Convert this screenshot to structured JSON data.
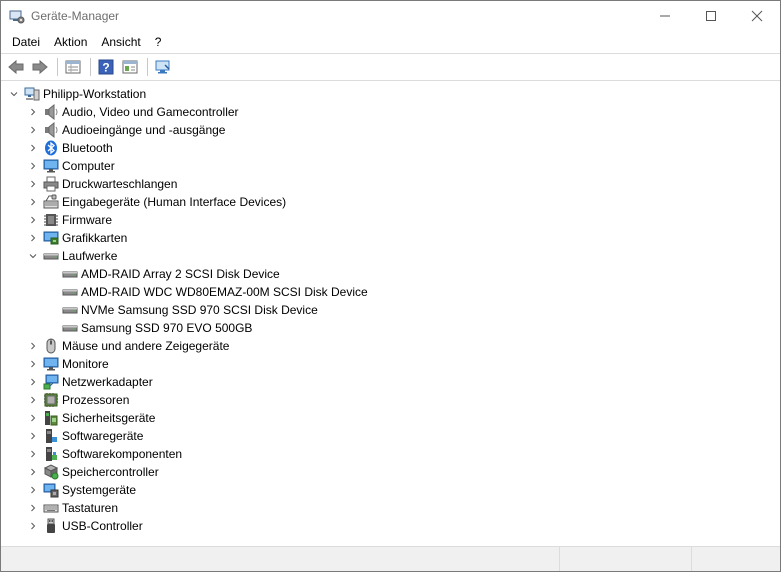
{
  "window": {
    "title": "Geräte-Manager"
  },
  "menu": [
    "Datei",
    "Aktion",
    "Ansicht",
    "?"
  ],
  "toolbar": {
    "buttons": [
      "back-icon",
      "forward-icon",
      "properties-icon",
      "help-icon",
      "show-hidden-icon",
      "scan-hardware-icon"
    ]
  },
  "tree": {
    "root": "Philipp-Workstation",
    "categories": [
      {
        "label": "Audio, Video und Gamecontroller",
        "icon": "speaker-icon"
      },
      {
        "label": "Audioeingänge und -ausgänge",
        "icon": "speaker-icon"
      },
      {
        "label": "Bluetooth",
        "icon": "bluetooth-icon"
      },
      {
        "label": "Computer",
        "icon": "computer-icon"
      },
      {
        "label": "Druckwarteschlangen",
        "icon": "printer-icon"
      },
      {
        "label": "Eingabegeräte (Human Interface Devices)",
        "icon": "keyboard-mouse-icon"
      },
      {
        "label": "Firmware",
        "icon": "chip-icon"
      },
      {
        "label": "Grafikkarten",
        "icon": "display-adapter-icon"
      },
      {
        "label": "Laufwerke",
        "icon": "disk-drive-icon",
        "expanded": true,
        "children": [
          {
            "label": "AMD-RAID Array 2  SCSI Disk Device"
          },
          {
            "label": "AMD-RAID WDC WD80EMAZ-00M SCSI Disk Device"
          },
          {
            "label": "NVMe Samsung SSD 970 SCSI Disk Device"
          },
          {
            "label": "Samsung SSD 970 EVO 500GB"
          }
        ]
      },
      {
        "label": "Mäuse und andere Zeigegeräte",
        "icon": "mouse-icon"
      },
      {
        "label": "Monitore",
        "icon": "monitor-icon"
      },
      {
        "label": "Netzwerkadapter",
        "icon": "network-icon"
      },
      {
        "label": "Prozessoren",
        "icon": "processor-icon"
      },
      {
        "label": "Sicherheitsgeräte",
        "icon": "security-device-icon"
      },
      {
        "label": "Softwaregeräte",
        "icon": "software-device-icon"
      },
      {
        "label": "Softwarekomponenten",
        "icon": "software-component-icon"
      },
      {
        "label": "Speichercontroller",
        "icon": "storage-controller-icon"
      },
      {
        "label": "Systemgeräte",
        "icon": "system-device-icon"
      },
      {
        "label": "Tastaturen",
        "icon": "keyboard-icon"
      },
      {
        "label": "USB-Controller",
        "icon": "usb-icon"
      }
    ]
  },
  "colors": {
    "accent_blue": "#1e6fd9",
    "icon_gray": "#6b6b6b",
    "border": "#dcdcdc"
  }
}
